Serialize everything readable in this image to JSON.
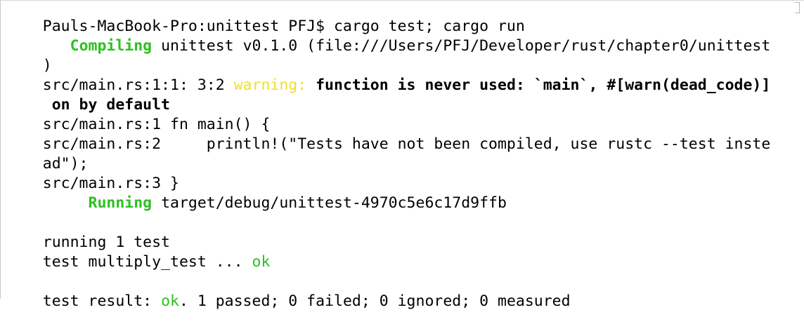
{
  "terminal": {
    "prompt": "Pauls-MacBook-Pro:unittest PFJ$ cargo test; cargo run",
    "compiling_label": "Compiling",
    "compiling_text": " unittest v0.1.0 (file:///Users/PFJ/Developer/rust/chapter0/unittest",
    "compiling_wrap": ")",
    "warn_loc": "src/main.rs:1:1: 3:2 ",
    "warn_label": "warning:",
    "warn_msg": " function is never used: `main`, #[warn(dead_code)]",
    "warn_msg_wrap": " on by default",
    "src_line1": "src/main.rs:1 fn main() {",
    "src_line2": "src/main.rs:2     println!(\"Tests have not been compiled, use rustc --test inste",
    "src_line2_wrap": "ad\");",
    "src_line3": "src/main.rs:3 }",
    "running_label": "Running",
    "running_text": " target/debug/unittest-4970c5e6c17d9ffb",
    "running_tests": "running 1 test",
    "test_name": "test multiply_test ... ",
    "test_status": "ok",
    "result_prefix": "test result: ",
    "result_status": "ok",
    "result_summary": ". 1 passed; 0 failed; 0 ignored; 0 measured"
  },
  "colors": {
    "green": "#2ec021",
    "yellow": "#eedf2c",
    "text": "#000000",
    "background": "#ffffff"
  }
}
